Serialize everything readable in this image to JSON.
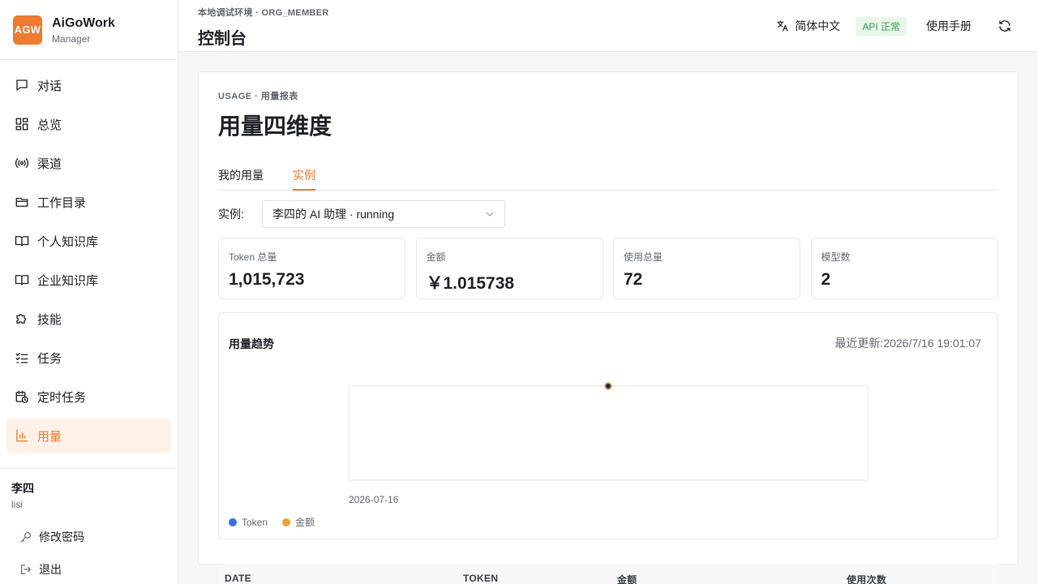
{
  "brand": {
    "logo": "AGW",
    "name": "AiGoWork",
    "sub": "Manager",
    "accent": "#ef7a30"
  },
  "sidebar": {
    "items": [
      {
        "label": "对话",
        "icon": "chat-icon"
      },
      {
        "label": "总览",
        "icon": "dashboard-icon"
      },
      {
        "label": "渠道",
        "icon": "broadcast-icon"
      },
      {
        "label": "工作目录",
        "icon": "folder-icon"
      },
      {
        "label": "个人知识库",
        "icon": "book-icon"
      },
      {
        "label": "企业知识库",
        "icon": "book-icon"
      },
      {
        "label": "技能",
        "icon": "puzzle-icon"
      },
      {
        "label": "任务",
        "icon": "checklist-icon"
      },
      {
        "label": "定时任务",
        "icon": "calendar-clock-icon"
      },
      {
        "label": "用量",
        "icon": "bar-chart-icon",
        "active": true
      }
    ]
  },
  "user": {
    "name": "李四",
    "id": "lisi",
    "change_password": "修改密码",
    "logout": "退出"
  },
  "header": {
    "env": "本地调试环境 · ORG_MEMBER",
    "title": "控制台",
    "language": "简体中文",
    "api_status": "API 正常",
    "manual": "使用手册"
  },
  "main": {
    "eyebrow": "USAGE · 用量报表",
    "title": "用量四维度",
    "tabs": [
      {
        "label": "我的用量"
      },
      {
        "label": "实例",
        "active": true
      }
    ],
    "instance_label": "实例:",
    "instance_value": "李四的 AI 助理 · running",
    "stats": [
      {
        "label": "Token 总量",
        "value": "1,015,723"
      },
      {
        "label": "金额",
        "value": "￥1.015738"
      },
      {
        "label": "使用总量",
        "value": "72"
      },
      {
        "label": "模型数",
        "value": "2"
      }
    ],
    "chart_title": "用量趋势",
    "chart_updated": "最近更新:2026/7/16 19:01:07",
    "table_headers": [
      "DATE",
      "TOKEN",
      "金额",
      "使用次数"
    ]
  },
  "chart_data": {
    "type": "line",
    "x": [
      "2026-07-16"
    ],
    "series": [
      {
        "name": "Token",
        "values": [
          1015723
        ],
        "color": "#3b6fe0"
      },
      {
        "name": "金额",
        "values": [
          1.015738
        ],
        "color": "#e8a13a"
      }
    ],
    "grid": false,
    "legend": "bottom-left"
  }
}
